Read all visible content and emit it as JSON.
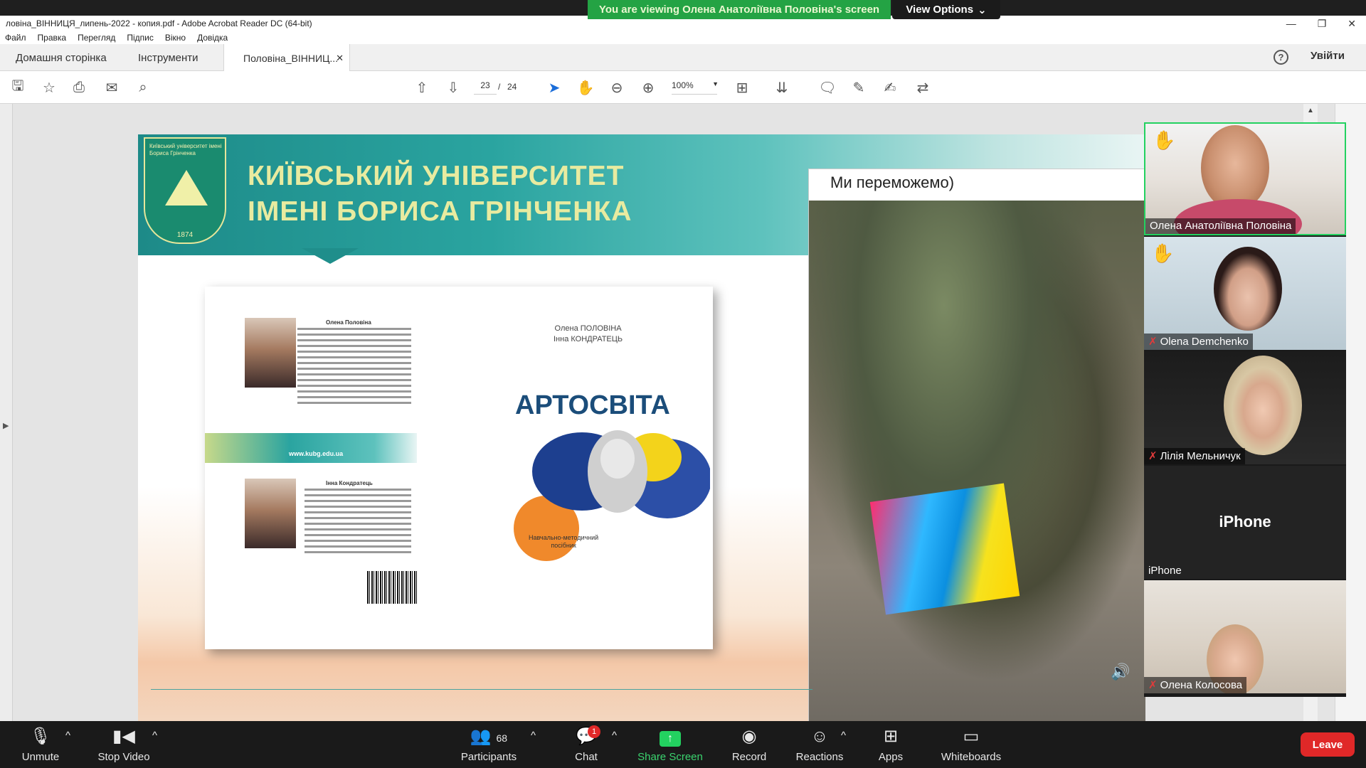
{
  "zoom": {
    "banner_text": "You are viewing Олена Анатоліївна Половіна's screen",
    "view_options_label": "View Options",
    "view_label": "View",
    "bottom_bar": {
      "unmute": "Unmute",
      "stop_video": "Stop Video",
      "participants": "Participants",
      "participants_count": "68",
      "chat": "Chat",
      "chat_badge": "1",
      "share_screen": "Share Screen",
      "record": "Record",
      "reactions": "Reactions",
      "apps": "Apps",
      "whiteboards": "Whiteboards",
      "leave": "Leave"
    },
    "gallery": [
      {
        "name": "Олена Анатоліївна Половіна",
        "hand_raised": true,
        "muted": false,
        "active": true
      },
      {
        "name": "Olena Demchenko",
        "hand_raised": true,
        "muted": true,
        "active": false
      },
      {
        "name": "Лілія Мельничук",
        "hand_raised": false,
        "muted": true,
        "active": false
      },
      {
        "name": "iPhone",
        "hand_raised": false,
        "muted": false,
        "active": false,
        "no_video_label": "iPhone"
      },
      {
        "name": "Олена Колосова",
        "hand_raised": false,
        "muted": true,
        "active": false
      }
    ]
  },
  "acrobat": {
    "window_title": "ловіна_ВІННИЦЯ_липень-2022 - копия.pdf - Adobe Acrobat Reader DC (64-bit)",
    "menu": [
      "Файл",
      "Правка",
      "Перегляд",
      "Підпис",
      "Вікно",
      "Довідка"
    ],
    "tabs": {
      "home": "Домашня сторінка",
      "tools": "Інструменти",
      "doc": "Половіна_ВІННИЦ..."
    },
    "sign_in": "Увійти",
    "help": "?",
    "page_current": "23",
    "page_sep": "/",
    "page_total": "24",
    "zoom_level": "100%"
  },
  "slide": {
    "university_line1": "КИЇВСЬКИЙ УНІВЕРСИТЕТ",
    "university_line2": "ІМЕНІ БОРИСА ГРІНЧЕНКА",
    "crest_caption": "Київський університет імені Бориса Грінченка",
    "crest_year": "1874",
    "book": {
      "author1_name": "Олена Половіна",
      "author2_name": "Інна Кондратець",
      "authors_front_line1": "Олена ПОЛОВІНА",
      "authors_front_line2": "Інна КОНДРАТЕЦЬ",
      "title": "АРТОСВІТА",
      "subtitle_line1": "Навчально-методичний",
      "subtitle_line2": "посібник",
      "url": "www.kubg.edu.ua"
    },
    "video_caption": "Ми переможемо)"
  }
}
